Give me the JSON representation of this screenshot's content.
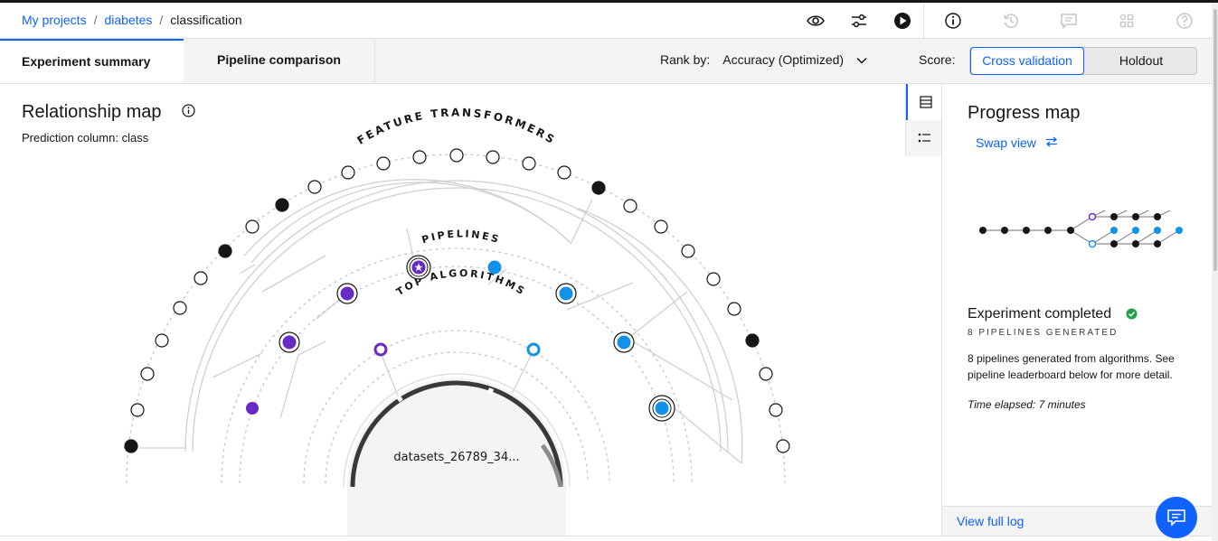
{
  "breadcrumb": {
    "project": "My projects",
    "asset": "diabetes",
    "current": "classification",
    "separator": "/"
  },
  "header_icons": [
    "view-icon",
    "settings-sliders-icon",
    "run-icon",
    "info-icon",
    "history-icon",
    "comment-icon",
    "apps-icon",
    "help-icon"
  ],
  "tabs": [
    {
      "label": "Experiment summary",
      "active": true
    },
    {
      "label": "Pipeline comparison",
      "active": false
    }
  ],
  "rank": {
    "label": "Rank by:",
    "value": "Accuracy (Optimized)"
  },
  "score": {
    "label": "Score:",
    "options": [
      "Cross validation",
      "Holdout"
    ],
    "selected": "Cross validation"
  },
  "relationship_map": {
    "title": "Relationship map",
    "prediction_label": "Prediction column:",
    "prediction_value": "class",
    "ring_labels": {
      "outer": "FEATURE TRANSFORMERS",
      "middle": "PIPELINES",
      "inner": "TOP ALGORITHMS"
    },
    "dataset": "datasets_26789_34..."
  },
  "progress_map": {
    "title": "Progress map",
    "swap_label": "Swap view",
    "status": "Experiment completed",
    "pipelines_generated": "8 PIPELINES GENERATED",
    "description": "8 pipelines generated from algorithms. See pipeline leaderboard below for more detail.",
    "elapsed": "Time elapsed: 7 minutes",
    "log_link": "View full log"
  },
  "colors": {
    "accent": "#0f62fe",
    "purple": "#6929c4",
    "blue": "#1192e8",
    "success": "#24a148",
    "node_dark": "#161616"
  }
}
